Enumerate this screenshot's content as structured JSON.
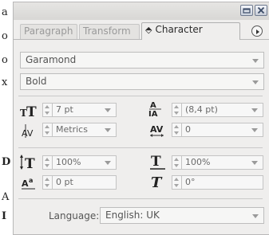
{
  "background_document": {
    "lines": [
      "a",
      "o",
      "o",
      "x",
      "D",
      "A",
      "I"
    ]
  },
  "panel": {
    "tabs": [
      {
        "label": "Paragraph",
        "active": false
      },
      {
        "label": "Transform",
        "active": false
      },
      {
        "label": "Character",
        "active": true
      }
    ],
    "font_family": "Garamond",
    "font_style": "Bold",
    "font_size": "7 pt",
    "leading": "(8,4 pt)",
    "kerning": "Metrics",
    "tracking": "0",
    "vertical_scale": "100%",
    "horizontal_scale": "100%",
    "baseline_shift": "0 pt",
    "character_rotation": "0°",
    "language_label": "Language:",
    "language": "English: UK"
  },
  "colors": {
    "panel_bg": "#efeeed",
    "border": "#b8b8b8",
    "text_dim": "#9a9a9a"
  }
}
